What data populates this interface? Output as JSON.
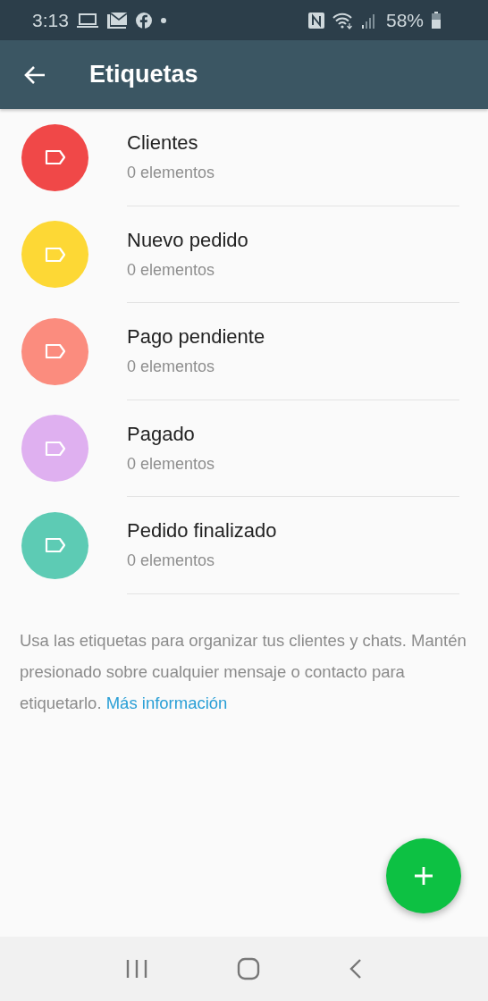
{
  "status_bar": {
    "time": "3:13",
    "battery": "58%"
  },
  "app_bar": {
    "title": "Etiquetas"
  },
  "labels": [
    {
      "name": "Clientes",
      "count": "0 elementos",
      "color": "#f04848"
    },
    {
      "name": "Nuevo pedido",
      "count": "0 elementos",
      "color": "#fdd835"
    },
    {
      "name": "Pago pendiente",
      "count": "0 elementos",
      "color": "#fb8c7e"
    },
    {
      "name": "Pagado",
      "count": "0 elementos",
      "color": "#dfb0f0"
    },
    {
      "name": "Pedido finalizado",
      "count": "0 elementos",
      "color": "#5dcbb4"
    }
  ],
  "info": {
    "text": "Usa las etiquetas para organizar tus clientes y chats. Mantén presionado sobre cualquier mensaje o contacto para etiquetarlo.",
    "link": "Más información"
  }
}
